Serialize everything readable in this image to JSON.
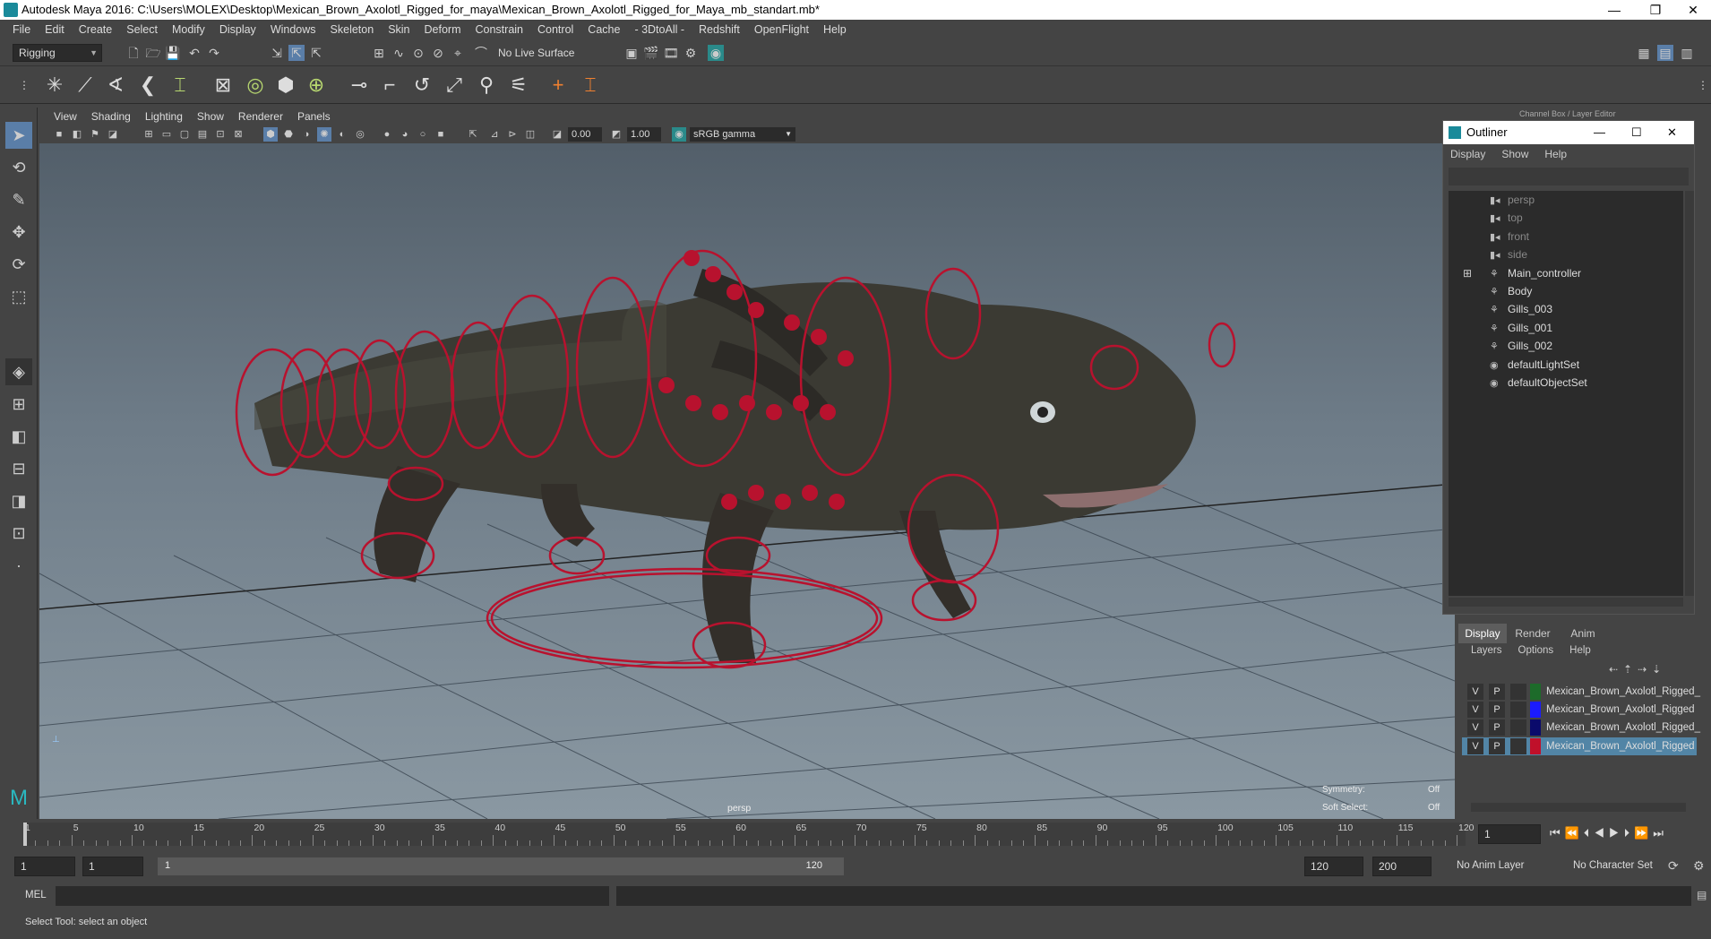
{
  "window": {
    "title": "Autodesk Maya 2016: C:\\Users\\MOLEX\\Desktop\\Mexican_Brown_Axolotl_Rigged_for_maya\\Mexican_Brown_Axolotl_Rigged_for_Maya_mb_standart.mb*",
    "minimize": "—",
    "restore": "❐",
    "close": "✕"
  },
  "menubar": [
    "File",
    "Edit",
    "Create",
    "Select",
    "Modify",
    "Display",
    "Windows",
    "Skeleton",
    "Skin",
    "Deform",
    "Constrain",
    "Control",
    "Cache",
    "- 3DtoAll -",
    "Redshift",
    "OpenFlight",
    "Help"
  ],
  "statusline": {
    "menuset": "Rigging",
    "live_surface": "No Live Surface"
  },
  "viewport": {
    "menu": [
      "View",
      "Shading",
      "Lighting",
      "Show",
      "Renderer",
      "Panels"
    ],
    "near_value": "0.00",
    "far_value": "1.00",
    "color_space": "sRGB gamma",
    "camera_label": "persp",
    "symmetry_label": "Symmetry:",
    "symmetry_value": "Off",
    "soft_select_label": "Soft Select:",
    "soft_select_value": "Off"
  },
  "channel_box_title": "Channel Box / Layer Editor",
  "outliner": {
    "title": "Outliner",
    "menu": [
      "Display",
      "Show",
      "Help"
    ],
    "items": [
      {
        "label": "persp",
        "icon": "camera-icon",
        "dim": true
      },
      {
        "label": "top",
        "icon": "camera-icon",
        "dim": true
      },
      {
        "label": "front",
        "icon": "camera-icon",
        "dim": true
      },
      {
        "label": "side",
        "icon": "camera-icon",
        "dim": true
      },
      {
        "label": "Main_controller",
        "icon": "transform-icon",
        "dim": false,
        "expandable": true
      },
      {
        "label": "Body",
        "icon": "transform-icon",
        "dim": false
      },
      {
        "label": "Gills_003",
        "icon": "transform-icon",
        "dim": false
      },
      {
        "label": "Gills_001",
        "icon": "transform-icon",
        "dim": false
      },
      {
        "label": "Gills_002",
        "icon": "transform-icon",
        "dim": false
      },
      {
        "label": "defaultLightSet",
        "icon": "set-icon",
        "dim": false
      },
      {
        "label": "defaultObjectSet",
        "icon": "set-icon",
        "dim": false
      }
    ]
  },
  "layer_editor": {
    "tabs": [
      "Display",
      "Render",
      "Anim"
    ],
    "menu": [
      "Layers",
      "Options",
      "Help"
    ],
    "layers": [
      {
        "v": "V",
        "p": "P",
        "color": "#1d6b2a",
        "name": "Mexican_Brown_Axolotl_Rigged_",
        "selected": false
      },
      {
        "v": "V",
        "p": "P",
        "color": "#1b1bff",
        "name": "Mexican_Brown_Axolotl_Rigged",
        "selected": false
      },
      {
        "v": "V",
        "p": "P",
        "color": "#0a0a6b",
        "name": "Mexican_Brown_Axolotl_Rigged_",
        "selected": false
      },
      {
        "v": "V",
        "p": "P",
        "color": "#c0102a",
        "name": "Mexican_Brown_Axolotl_Rigged",
        "selected": true
      }
    ]
  },
  "timeline": {
    "ticks": [
      "1",
      "5",
      "10",
      "15",
      "20",
      "25",
      "30",
      "35",
      "40",
      "45",
      "50",
      "55",
      "60",
      "65",
      "70",
      "75",
      "80",
      "85",
      "90",
      "95",
      "100",
      "105",
      "110",
      "115",
      "120"
    ],
    "current_frame": "1"
  },
  "range": {
    "start": "1",
    "current": "1",
    "slider_start": "1",
    "slider_end": "120",
    "end": "120",
    "max": "200",
    "anim_layer": "No Anim Layer",
    "character_set": "No Character Set"
  },
  "cmdline": {
    "label": "MEL"
  },
  "helpline": "Select Tool: select an object"
}
